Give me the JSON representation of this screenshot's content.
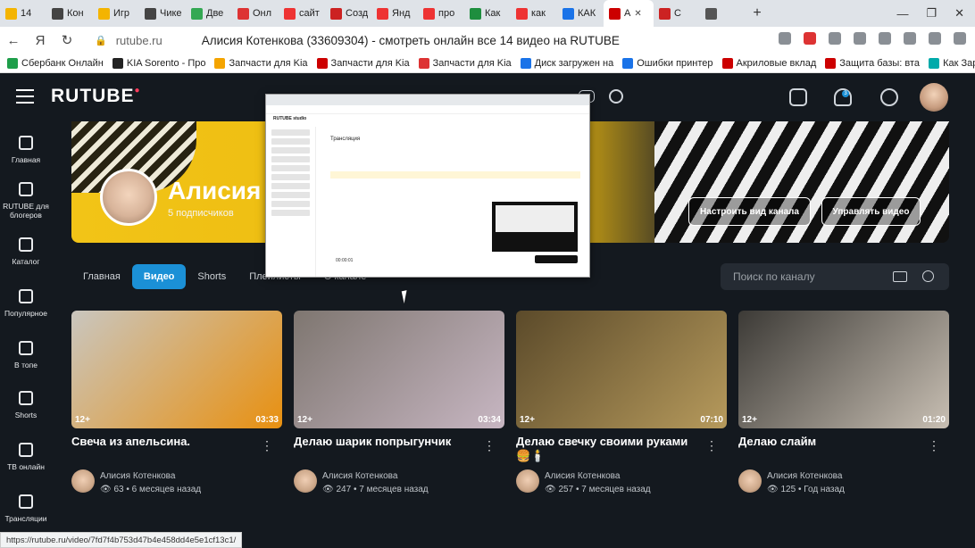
{
  "browser": {
    "tabs": [
      {
        "label": "14",
        "color": "#f4b400"
      },
      {
        "label": "Кон",
        "color": "#444"
      },
      {
        "label": "Игр",
        "color": "#f4b400"
      },
      {
        "label": "Чике",
        "color": "#444"
      },
      {
        "label": "Две",
        "color": "#34a853"
      },
      {
        "label": "Онл",
        "color": "#d33"
      },
      {
        "label": "сайт",
        "color": "#e33"
      },
      {
        "label": "Созд",
        "color": "#c22"
      },
      {
        "label": "Янд",
        "color": "#e33"
      },
      {
        "label": "про",
        "color": "#e33"
      },
      {
        "label": "Как",
        "color": "#1e8e3e"
      },
      {
        "label": "как",
        "color": "#e33"
      },
      {
        "label": "КАК",
        "color": "#1a73e8"
      },
      {
        "label": "А",
        "color": "#c00",
        "active": true
      },
      {
        "label": "С",
        "color": "#c22"
      },
      {
        "label": "",
        "color": "#555"
      }
    ],
    "url_host": "rutube.ru",
    "page_title": "Алисия Котенкова (33609304) - смотреть онлайн все 14 видео на RUTUBE",
    "bookmarks": [
      {
        "label": "Сбербанк Онлайн",
        "color": "#1e9e4a"
      },
      {
        "label": "KIA Sorento - Про",
        "color": "#222"
      },
      {
        "label": "Запчасти для Kia",
        "color": "#f4a400"
      },
      {
        "label": "Запчасти для Kia",
        "color": "#c00"
      },
      {
        "label": "Запчасти для Kia",
        "color": "#d33"
      },
      {
        "label": "Диск загружен на",
        "color": "#1a73e8"
      },
      {
        "label": "Ошибки принтер",
        "color": "#1a73e8"
      },
      {
        "label": "Акриловые вклад",
        "color": "#c00"
      },
      {
        "label": "Защита базы: вта",
        "color": "#c00"
      },
      {
        "label": "Как Зарабатыват",
        "color": "#0aa"
      }
    ],
    "status_url": "https://rutube.ru/video/7fd7f4b753d47b4e458dd4e5e1cf13c1/"
  },
  "header": {
    "logo": "RUTUBE",
    "logo_mark": "●",
    "notification_count": "3"
  },
  "sidebar": {
    "items": [
      {
        "label": "Главная"
      },
      {
        "label": "RUTUBE для блогеров"
      },
      {
        "label": "Каталог"
      },
      {
        "label": "Популярное"
      },
      {
        "label": "В топе"
      },
      {
        "label": "Shorts"
      },
      {
        "label": "ТВ онлайн"
      },
      {
        "label": "Трансляции"
      }
    ]
  },
  "channel": {
    "name": "Алисия",
    "subscribers": "5 подписчиков",
    "customize_button": "Настроить вид канала",
    "manage_button": "Управлять видео"
  },
  "tabs": [
    {
      "label": "Главная"
    },
    {
      "label": "Видео",
      "active": true
    },
    {
      "label": "Shorts"
    },
    {
      "label": "Плейлисты"
    },
    {
      "label": "О канале"
    }
  ],
  "search": {
    "placeholder": "Поиск по каналу"
  },
  "videos": [
    {
      "title": "Свеча из апельсина.",
      "age": "12+",
      "duration": "03:33",
      "author": "Алисия Котенкова",
      "views": "63",
      "date": "6 месяцев назад",
      "colors": [
        "#c9c6bf",
        "#e89010"
      ]
    },
    {
      "title": "Делаю шарик попрыгунчик",
      "age": "12+",
      "duration": "03:34",
      "author": "Алисия Котенкова",
      "views": "247",
      "date": "7 месяцев назад",
      "colors": [
        "#7e7670",
        "#c7b6c2"
      ]
    },
    {
      "title": "Делаю свечку своими руками 🍔🕯️",
      "age": "12+",
      "duration": "07:10",
      "author": "Алисия Котенкова",
      "views": "257",
      "date": "7 месяцев назад",
      "colors": [
        "#5b4a2a",
        "#b69a5c"
      ]
    },
    {
      "title": "Делаю слайм",
      "age": "12+",
      "duration": "01:20",
      "author": "Алисия Котенкова",
      "views": "125",
      "date": "Год назад",
      "colors": [
        "#3c3a36",
        "#c8bfb3"
      ]
    }
  ],
  "popup": {
    "title": "Трансляция",
    "logo": "RUTUBE studio",
    "time": "00:00:01"
  }
}
